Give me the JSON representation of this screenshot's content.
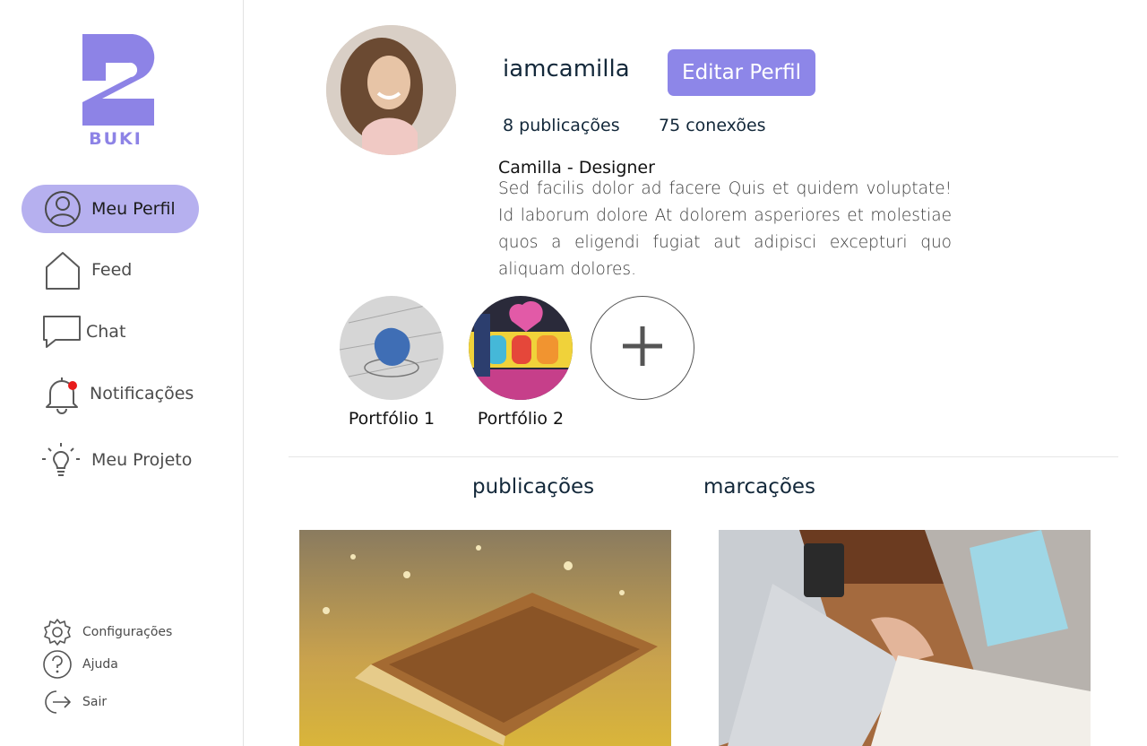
{
  "brand": {
    "name": "BUKI",
    "accent": "#8d86e8"
  },
  "sidebar": {
    "items": [
      {
        "label": "Meu Perfil",
        "icon": "user-circle-icon",
        "active": true
      },
      {
        "label": "Feed",
        "icon": "home-icon"
      },
      {
        "label": "Chat",
        "icon": "chat-bubble-icon"
      },
      {
        "label": "Notificações",
        "icon": "bell-icon",
        "badge": true
      },
      {
        "label": "Meu Projeto",
        "icon": "lightbulb-icon"
      }
    ],
    "footer": [
      {
        "label": "Configurações",
        "icon": "gear-icon"
      },
      {
        "label": "Ajuda",
        "icon": "help-icon"
      },
      {
        "label": "Sair",
        "icon": "logout-icon"
      }
    ]
  },
  "profile": {
    "username": "iamcamilla",
    "edit_label": "Editar Perfil",
    "posts_count": "8 publicações",
    "connections_count": "75 conexões",
    "bio_title": "Camilla - Designer",
    "bio_text": "Sed facilis dolor ad facere Quis et quidem voluptate! Id laborum dolore At dolorem asperiores et molestiae quos a eligendi fugiat aut adipisci excepturi quo aliquam dolores."
  },
  "highlights": [
    {
      "label": "Portfólio 1"
    },
    {
      "label": "Portfólio 2"
    }
  ],
  "tabs": {
    "posts": "publicações",
    "tags": "marcações"
  }
}
